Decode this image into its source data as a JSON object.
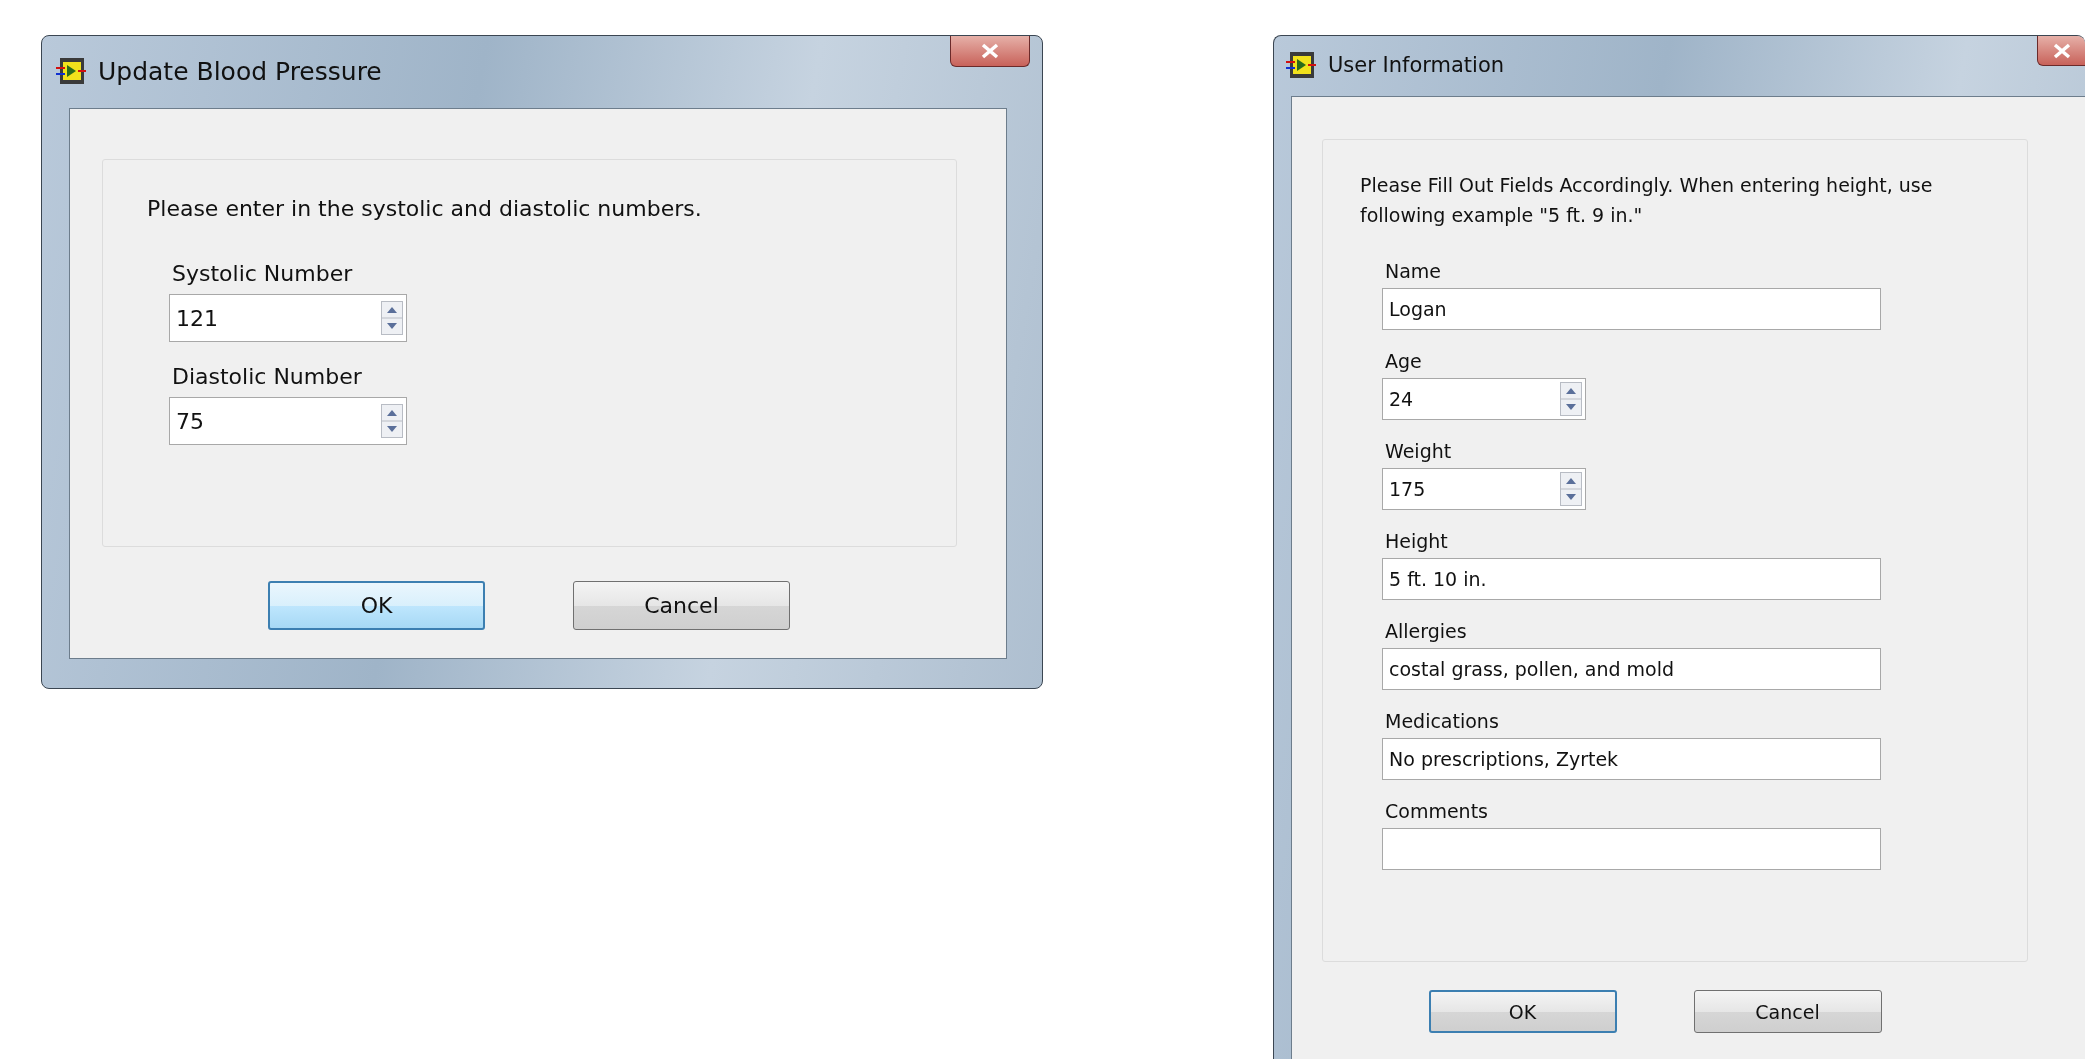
{
  "dialogs": [
    {
      "title": "Update Blood Pressure",
      "prompt": "Please enter in the systolic and diastolic numbers.",
      "fields": [
        {
          "label": "Systolic Number",
          "value": "121",
          "kind": "spin"
        },
        {
          "label": "Diastolic Number",
          "value": "75",
          "kind": "spin"
        }
      ],
      "buttons": [
        {
          "label": "OK",
          "focused": true,
          "hovered": true
        },
        {
          "label": "Cancel",
          "focused": false,
          "hovered": false
        }
      ]
    },
    {
      "title": "User Information",
      "prompt": "Please Fill Out Fields Accordingly. When entering height, use following example \"5 ft. 9 in.\"",
      "fields": [
        {
          "label": "Name",
          "value": "Logan",
          "kind": "text"
        },
        {
          "label": "Age",
          "value": "24",
          "kind": "spin"
        },
        {
          "label": "Weight",
          "value": "175",
          "kind": "spin"
        },
        {
          "label": "Height",
          "value": "5 ft. 10 in.",
          "kind": "text"
        },
        {
          "label": "Allergies",
          "value": "costal grass, pollen, and mold",
          "kind": "text"
        },
        {
          "label": "Medications",
          "value": "No prescriptions, Zyrtek",
          "kind": "text"
        },
        {
          "label": "Comments",
          "kind": "text"
        }
      ],
      "buttons": [
        {
          "label": "OK",
          "focused": true,
          "hovered": false
        },
        {
          "label": "Cancel",
          "focused": false,
          "hovered": false
        }
      ]
    }
  ]
}
